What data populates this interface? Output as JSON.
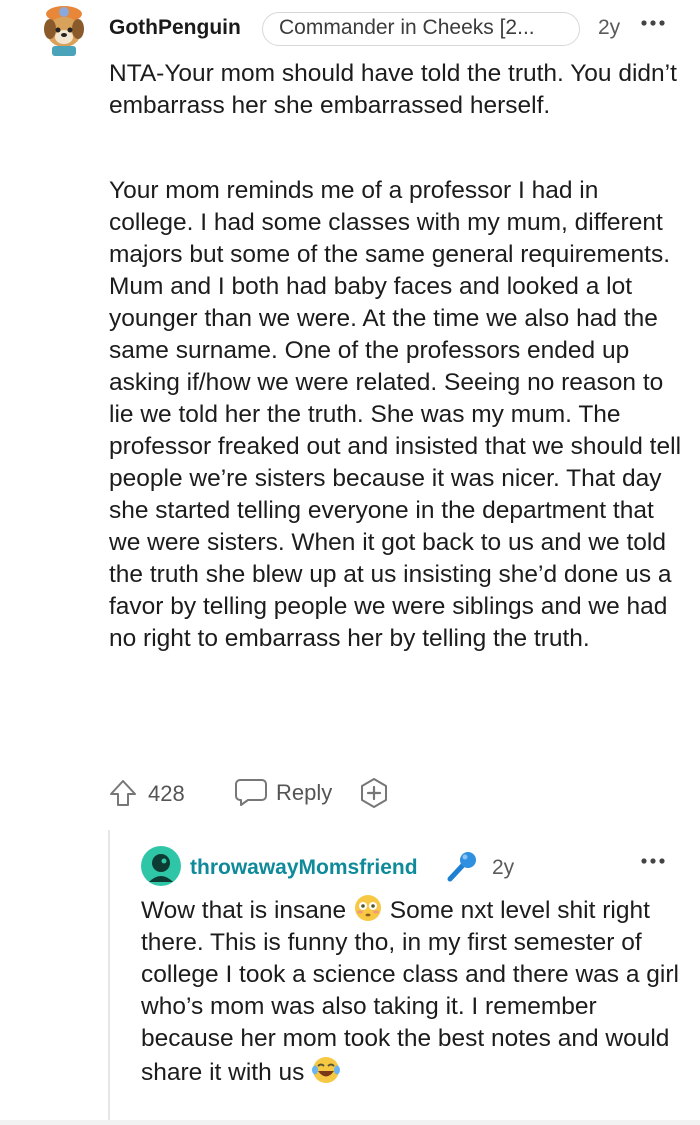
{
  "comment": {
    "username": "GothPenguin",
    "flair": "Commander in Cheeks [2...",
    "time": "2y",
    "paragraphs": [
      "NTA-Your mom should have told the truth. You didn’t embarrass her she embarrassed herself.",
      "Your mom reminds me of a professor I had in college. I had some classes with my mum, different majors but some of the same general requirements. Mum and I both had baby faces and looked a lot younger than we were. At the time we also had the same surname. One of the professors ended up asking if/how we were related. Seeing no reason to lie we told her the truth. She was my mum. The professor freaked out and insisted that we should tell people we’re sisters because it was nicer. That day she started telling everyone in the department that we were sisters. When it got back to us and we told the truth she blew up at us insisting she’d done us a favor by telling people we were siblings and we had no right to embarrass her by telling the truth."
    ],
    "score": "428",
    "reply_label": "Reply"
  },
  "reply": {
    "username": "throwawayMomsfriend",
    "time": "2y",
    "text_part1": "Wow that is insane ",
    "text_part2": " Some nxt level shit right there. This is funny tho, in my first semester of college I took a science class and there was a girl who’s mom was also taking it. I remember because her mom took the best notes and would share it with us ",
    "emoji1": "flushed-face",
    "emoji2": "laughing-with-tears"
  },
  "colors": {
    "reply_username": "#0f8a9a",
    "text": "#1c1c1c",
    "meta": "#5a5a5a"
  }
}
